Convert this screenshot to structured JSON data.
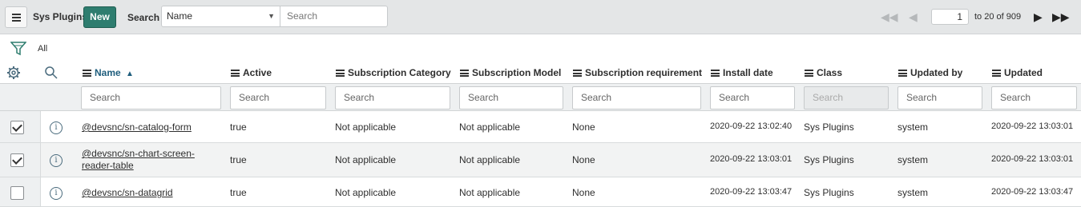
{
  "header": {
    "title": "Sys Plugins",
    "new_label": "New",
    "search_label": "Search",
    "field_selected": "Name",
    "search_placeholder": "Search",
    "page_input": "1",
    "page_text": "to 20 of 909"
  },
  "breadcrumb": {
    "all_label": "All"
  },
  "columns": [
    {
      "label": "Name",
      "sorted": true,
      "sort_icon": "▲"
    },
    {
      "label": "Active"
    },
    {
      "label": "Subscription Category"
    },
    {
      "label": "Subscription Model"
    },
    {
      "label": "Subscription requirement"
    },
    {
      "label": "Install date"
    },
    {
      "label": "Class"
    },
    {
      "label": "Updated by"
    },
    {
      "label": "Updated"
    }
  ],
  "column_search_placeholder": "Search",
  "rows": [
    {
      "checked": true,
      "name": "@devsnc/sn-catalog-form",
      "active": "true",
      "sub_category": "Not applicable",
      "sub_model": "Not applicable",
      "sub_requirement": "None",
      "install_date": "2020-09-22 13:02:40",
      "class": "Sys Plugins",
      "updated_by": "system",
      "updated": "2020-09-22 13:03:01"
    },
    {
      "checked": true,
      "name": "@devsnc/sn-chart-screen-reader-table",
      "active": "true",
      "sub_category": "Not applicable",
      "sub_model": "Not applicable",
      "sub_requirement": "None",
      "install_date": "2020-09-22 13:03:01",
      "class": "Sys Plugins",
      "updated_by": "system",
      "updated": "2020-09-22 13:03:01"
    },
    {
      "checked": false,
      "name": "@devsnc/sn-datagrid",
      "active": "true",
      "sub_category": "Not applicable",
      "sub_model": "Not applicable",
      "sub_requirement": "None",
      "install_date": "2020-09-22 13:03:47",
      "class": "Sys Plugins",
      "updated_by": "system",
      "updated": "2020-09-22 13:03:47"
    }
  ],
  "icons": {
    "menu": "hamburger-icon",
    "filter": "funnel-icon",
    "settings": "gear-icon",
    "search": "magnifier-icon",
    "info": "info-icon",
    "first": "first-page-icon",
    "prev": "previous-page-icon",
    "next": "next-page-icon",
    "last": "last-page-icon"
  },
  "colors": {
    "accent": "#2e7d6f",
    "header_bg": "#e4e6e7",
    "alt_row": "#f2f3f3"
  }
}
